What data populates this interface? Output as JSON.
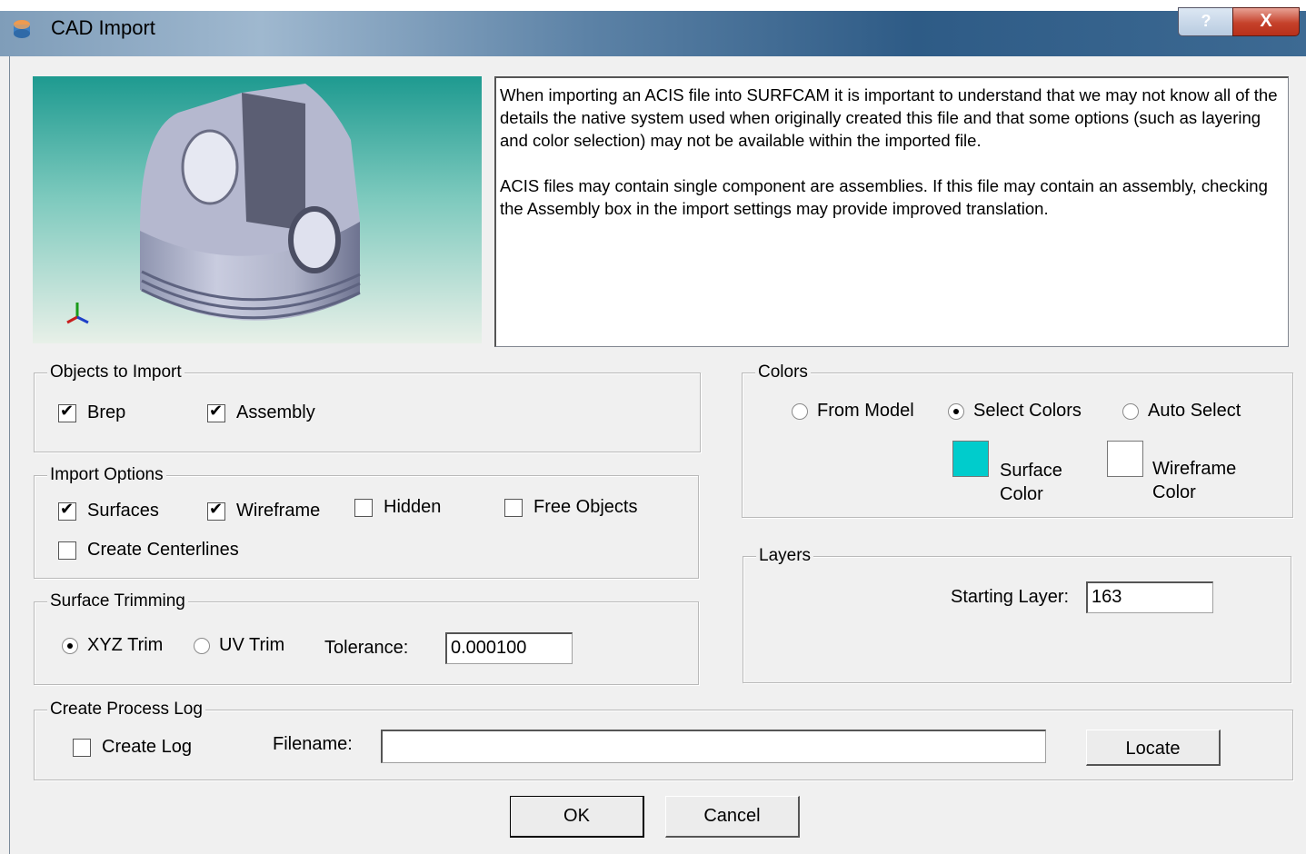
{
  "window": {
    "title": "CAD Import",
    "help_label": "?",
    "close_label": "X"
  },
  "description": {
    "para1": "When importing an ACIS file into SURFCAM it is important to understand that we may not know all of the details the native system used when originally created this file and that some options (such as layering and color selection) may not be available within the imported file.",
    "para2": "ACIS files may contain single component are assemblies. If this file may contain an assembly, checking the Assembly box in the import settings may provide improved translation."
  },
  "objects_to_import": {
    "legend": "Objects to Import",
    "brep": {
      "label": "Brep",
      "checked": true
    },
    "assembly": {
      "label": "Assembly",
      "checked": true
    }
  },
  "import_options": {
    "legend": "Import Options",
    "surfaces": {
      "label": "Surfaces",
      "checked": true
    },
    "wireframe": {
      "label": "Wireframe",
      "checked": true
    },
    "hidden": {
      "label": "Hidden",
      "checked": false
    },
    "free_objects": {
      "label": "Free Objects",
      "checked": false
    },
    "create_centerlines": {
      "label": "Create Centerlines",
      "checked": false
    }
  },
  "surface_trimming": {
    "legend": "Surface Trimming",
    "xyz_trim": {
      "label": "XYZ Trim",
      "selected": true
    },
    "uv_trim": {
      "label": "UV Trim",
      "selected": false
    },
    "tolerance_label": "Tolerance:",
    "tolerance_value": "0.000100"
  },
  "colors": {
    "legend": "Colors",
    "from_model": {
      "label": "From Model",
      "selected": false
    },
    "select_colors": {
      "label": "Select Colors",
      "selected": true
    },
    "auto_select": {
      "label": "Auto Select",
      "selected": false
    },
    "surface_color": {
      "line1": "Surface",
      "line2": "Color",
      "hex": "#00cccc"
    },
    "wireframe_color": {
      "line1": "Wireframe",
      "line2": "Color",
      "hex": "#ffffff"
    }
  },
  "layers": {
    "legend": "Layers",
    "starting_layer_label": "Starting Layer:",
    "starting_layer_value": "163"
  },
  "process_log": {
    "legend": "Create Process Log",
    "create_log": {
      "label": "Create Log",
      "checked": false
    },
    "filename_label": "Filename:",
    "filename_value": "",
    "locate_label": "Locate"
  },
  "buttons": {
    "ok": "OK",
    "cancel": "Cancel"
  },
  "icons": {
    "app": "cad-import-app-icon",
    "axis": "xyz-axis-triad-icon"
  }
}
